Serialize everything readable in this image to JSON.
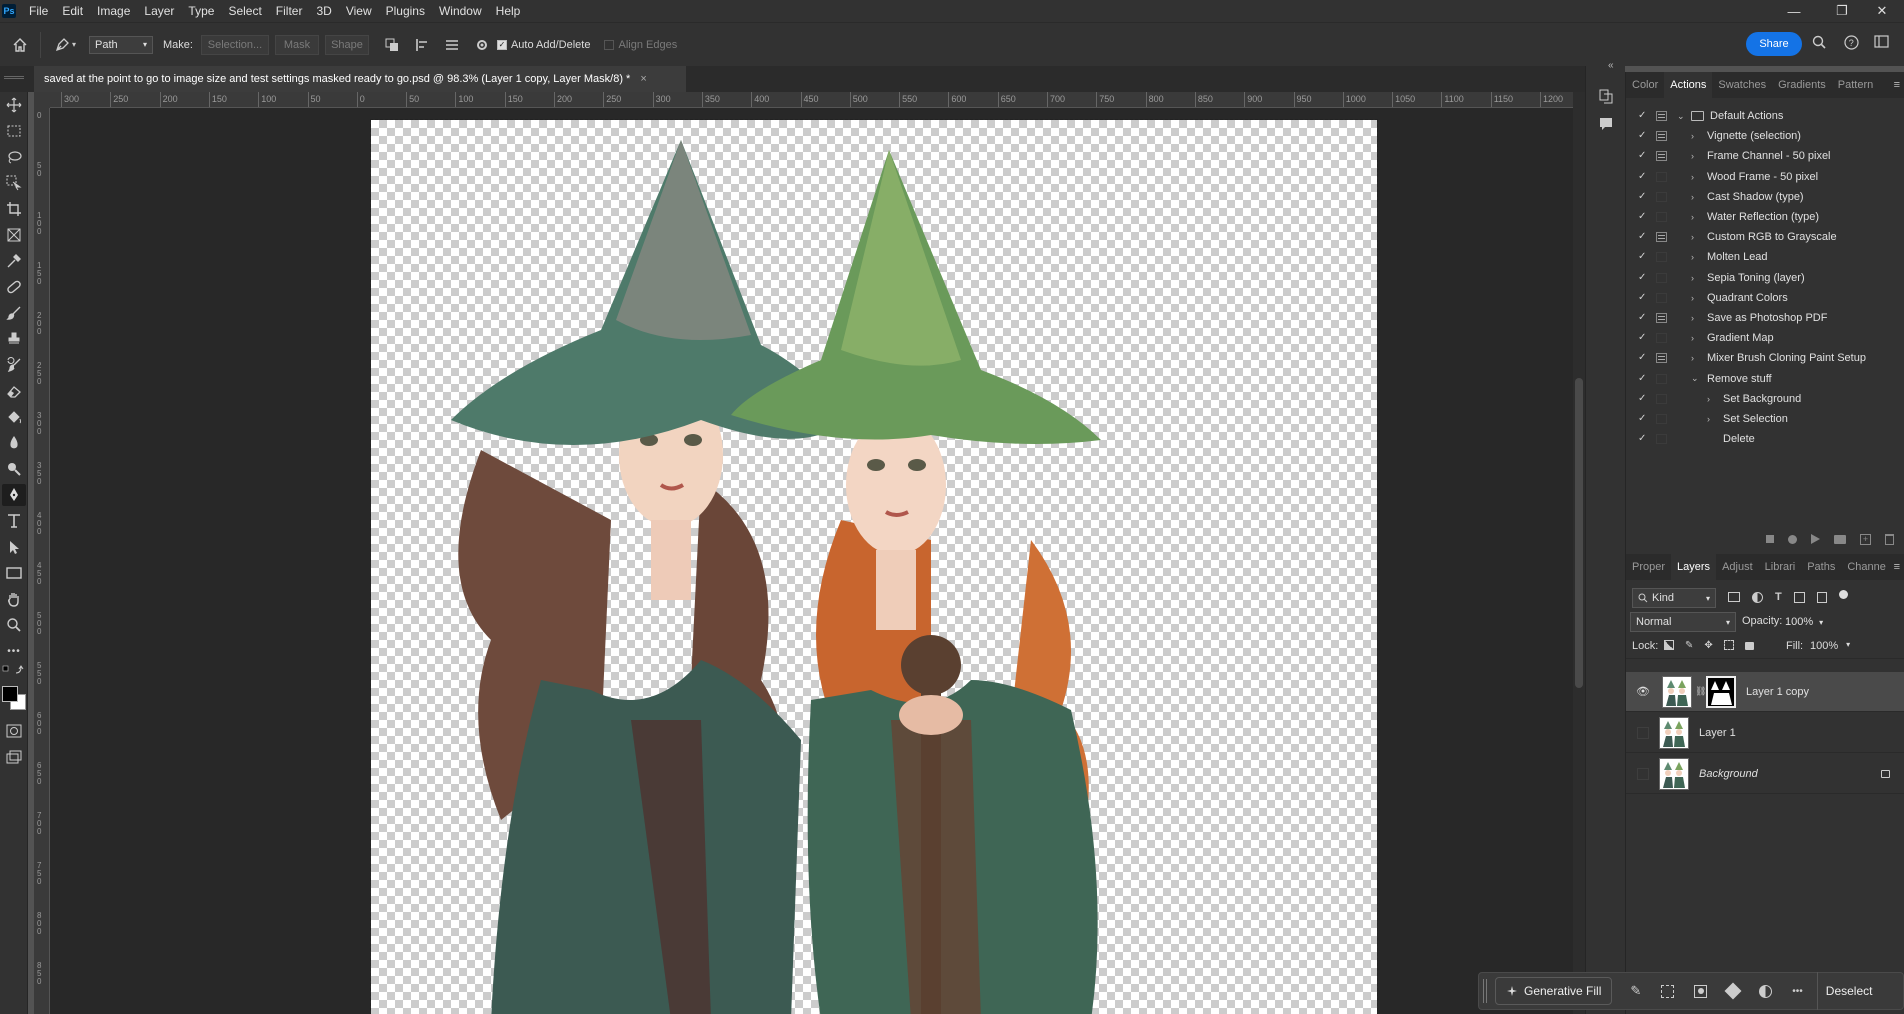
{
  "app": {
    "logo": "Ps"
  },
  "menu": [
    "File",
    "Edit",
    "Image",
    "Layer",
    "Type",
    "Select",
    "Filter",
    "3D",
    "View",
    "Plugins",
    "Window",
    "Help"
  ],
  "window_controls": {
    "minimize": "—",
    "restore": "❐",
    "close": "✕"
  },
  "options_bar": {
    "tool_mode": "Path",
    "make_label": "Make:",
    "selection_btn": "Selection...",
    "mask_btn": "Mask",
    "shape_btn": "Shape",
    "auto_add_delete": "Auto Add/Delete",
    "align_edges": "Align Edges",
    "share": "Share"
  },
  "document_tab": {
    "title": "saved at the point to go to image size and test settings masked ready to go.psd @ 98.3% (Layer 1 copy, Layer Mask/8) *",
    "close": "×"
  },
  "ruler_h": [
    "300",
    "250",
    "200",
    "150",
    "100",
    "50",
    "0",
    "50",
    "100",
    "150",
    "200",
    "250",
    "300",
    "350",
    "400",
    "450",
    "500",
    "550",
    "600",
    "650",
    "700",
    "750",
    "800",
    "850",
    "900",
    "950",
    "1000",
    "1050",
    "1100",
    "1150",
    "1200"
  ],
  "ruler_v": [
    "0",
    "5 0",
    "1 0 0",
    "1 5 0",
    "2 0 0",
    "2 5 0",
    "3 0 0",
    "3 5 0",
    "4 0 0",
    "4 5 0",
    "5 0 0",
    "5 5 0",
    "6 0 0",
    "6 5 0",
    "7 0 0",
    "7 5 0",
    "8 0 0",
    "8 5 0"
  ],
  "actions_panel": {
    "tabs": [
      "Color",
      "Actions",
      "Swatches",
      "Gradients",
      "Pattern"
    ],
    "active_tab": "Actions",
    "items": [
      {
        "label": "Default Actions",
        "level": 0,
        "expanded": true,
        "folder": true,
        "dialog": true
      },
      {
        "label": "Vignette (selection)",
        "level": 1,
        "dialog": true
      },
      {
        "label": "Frame Channel - 50 pixel",
        "level": 1,
        "dialog": true
      },
      {
        "label": "Wood Frame - 50 pixel",
        "level": 1,
        "dialog": false
      },
      {
        "label": "Cast Shadow (type)",
        "level": 1,
        "dialog": false
      },
      {
        "label": "Water Reflection (type)",
        "level": 1,
        "dialog": false
      },
      {
        "label": "Custom RGB to Grayscale",
        "level": 1,
        "dialog": true
      },
      {
        "label": "Molten Lead",
        "level": 1,
        "dialog": false
      },
      {
        "label": "Sepia Toning (layer)",
        "level": 1,
        "dialog": false
      },
      {
        "label": "Quadrant Colors",
        "level": 1,
        "dialog": false
      },
      {
        "label": "Save as Photoshop PDF",
        "level": 1,
        "dialog": true
      },
      {
        "label": "Gradient Map",
        "level": 1,
        "dialog": false
      },
      {
        "label": "Mixer Brush Cloning Paint Setup",
        "level": 1,
        "dialog": true
      },
      {
        "label": "Remove stuff",
        "level": 1,
        "expanded": true,
        "dialog": false
      },
      {
        "label": "Set Background",
        "level": 2,
        "dialog": false
      },
      {
        "label": "Set Selection",
        "level": 2,
        "dialog": false
      },
      {
        "label": "Delete",
        "level": 2,
        "dialog": false,
        "leaf": true
      }
    ]
  },
  "layers_panel": {
    "tabs": [
      "Proper",
      "Layers",
      "Adjust",
      "Librari",
      "Paths",
      "Channe"
    ],
    "active_tab": "Layers",
    "filter_kind": "Kind",
    "blend_mode": "Normal",
    "opacity_label": "Opacity:",
    "opacity": "100%",
    "lock_label": "Lock:",
    "fill_label": "Fill:",
    "fill": "100%",
    "layers": [
      {
        "name": "Layer 1 copy",
        "visible": true,
        "selected": true,
        "mask": true,
        "italic": false,
        "locked": false
      },
      {
        "name": "Layer 1",
        "visible": false,
        "selected": false,
        "mask": false,
        "italic": false,
        "locked": false
      },
      {
        "name": "Background",
        "visible": false,
        "selected": false,
        "mask": false,
        "italic": true,
        "locked": true
      }
    ]
  },
  "context_bar": {
    "generative_fill": "Generative Fill",
    "deselect": "Deselect",
    "more": "•••"
  },
  "colors": {
    "accent": "#1473e6",
    "panel_bg": "#323232",
    "canvas_bg": "#282828"
  }
}
